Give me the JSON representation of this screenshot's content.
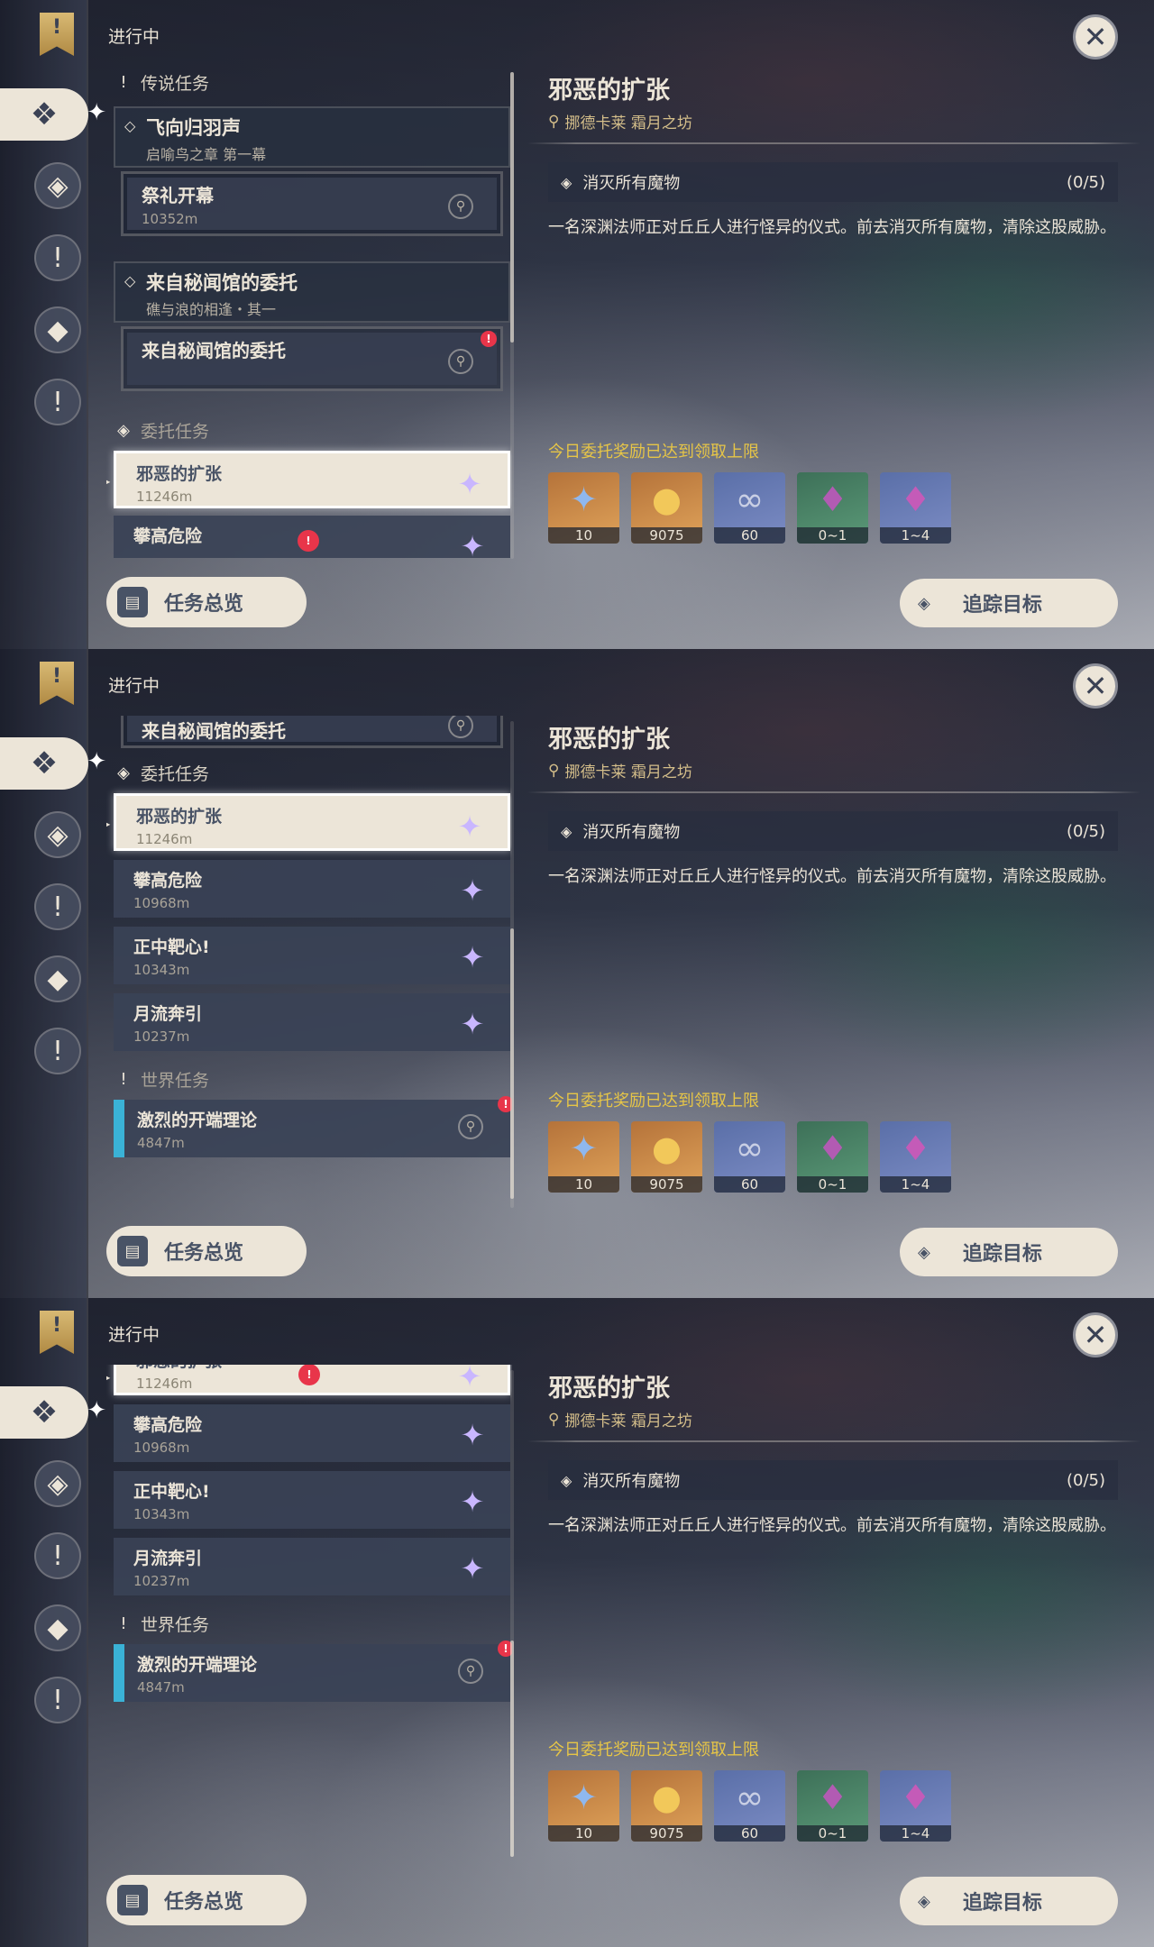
{
  "header": {
    "title": "进行中",
    "close_icon": "close-icon"
  },
  "sections": {
    "legend": "传说任务",
    "commission": "委托任务",
    "world": "世界任务"
  },
  "legend_quests": [
    {
      "title": "飞向归羽声",
      "subtitle": "启喻鸟之章 第一幕",
      "child": {
        "title": "祭礼开幕",
        "distance": "10352m"
      }
    },
    {
      "title": "来自秘闻馆的委托",
      "subtitle": "礁与浪的相逢・其一",
      "child": {
        "title": "来自秘闻馆的委托"
      }
    }
  ],
  "commissions": [
    {
      "title": "邪恶的扩张",
      "distance": "11246m"
    },
    {
      "title": "攀高危险",
      "distance": "10968m"
    },
    {
      "title": "正中靶心!",
      "distance": "10343m"
    },
    {
      "title": "月流奔引",
      "distance": "10237m"
    }
  ],
  "world_quests": [
    {
      "title": "激烈的开端理论",
      "distance": "4847m"
    }
  ],
  "footer": {
    "overview_label": "任务总览",
    "track_label": "追踪目标"
  },
  "detail": {
    "title": "邪恶的扩张",
    "location": "挪德卡莱 霜月之坊",
    "objective": "消灭所有魔物",
    "progress": "(0/5)",
    "description": "一名深渊法师正对丘丘人进行怪异的仪式。前去消灭所有魔物，清除这股威胁。",
    "reward_note": "今日委托奖励已达到领取上限",
    "rewards": [
      {
        "icon": "adventure-exp-icon",
        "qty": "10"
      },
      {
        "icon": "mora-icon",
        "qty": "9075"
      },
      {
        "icon": "companionship-exp-icon",
        "qty": "60"
      },
      {
        "icon": "crystal-ore-icon",
        "qty": "0~1"
      },
      {
        "icon": "crystal-chunk-icon",
        "qty": "1~4"
      }
    ]
  },
  "colors": {
    "accent": "#ece5d8",
    "reward_note": "#e6c547",
    "world_marker": "#3ab2d6",
    "alert": "#e8354a"
  }
}
